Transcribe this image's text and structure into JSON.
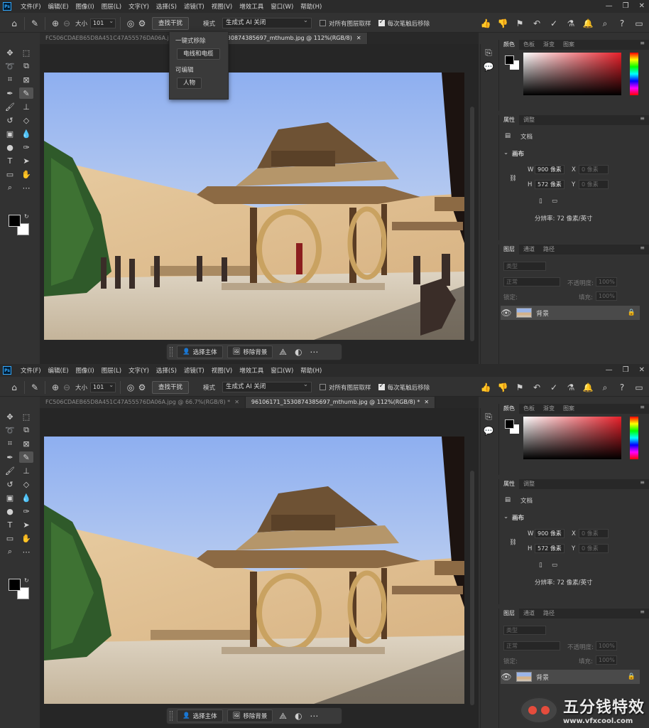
{
  "menu": [
    "文件(F)",
    "编辑(E)",
    "图像(I)",
    "图层(L)",
    "文字(Y)",
    "选择(S)",
    "滤镜(T)",
    "视图(V)",
    "增效工具",
    "窗口(W)",
    "帮助(H)"
  ],
  "options": {
    "size_label": "大小",
    "size_value": "101",
    "find_button": "查找干扰",
    "mode_label": "模式",
    "mode_value": "生成式 AI 关闭",
    "sample_all": "对所有图层取样",
    "remove_after": "每次笔触后移除"
  },
  "dropdown": {
    "heading1": "一键式移除",
    "item1": "电线和电缆",
    "heading2": "可编辑",
    "item2": "人物"
  },
  "tabs": {
    "top": [
      "FC506CDAEB65D8A451C47A55576DA06A.jpg",
      "96106171_1530874385697_mthumb.jpg @ 112%(RGB/8)"
    ],
    "bottom": [
      "FC506CDAEB65D8A451C47A55576DA06A.jpg @ 66.7%(RGB/8) *",
      "96106171_1530874385697_mthumb.jpg @ 112%(RGB/8) *"
    ]
  },
  "taskbar": {
    "select_subject": "选择主体",
    "remove_bg": "移除背景"
  },
  "color_panel": {
    "tabs": [
      "颜色",
      "色板",
      "渐变",
      "图案"
    ]
  },
  "properties": {
    "tabs": [
      "属性",
      "调整"
    ],
    "doc_label": "文档",
    "canvas_label": "画布",
    "w_label": "W",
    "w_value": "900 像素",
    "h_label": "H",
    "h_value": "572 像素",
    "x_label": "X",
    "x_placeholder": "0 像素",
    "y_label": "Y",
    "y_placeholder": "0 像素",
    "resolution": "分辨率: 72 像素/英寸"
  },
  "layers": {
    "tabs": [
      "图层",
      "通道",
      "路径"
    ],
    "kind_label": "类型",
    "blend_mode": "正常",
    "opacity_label": "不透明度:",
    "opacity_value": "100%",
    "lock_label": "锁定:",
    "fill_label": "填充:",
    "fill_value": "100%",
    "layer_name": "背景"
  },
  "watermark": {
    "cn": "五分钱特效",
    "url": "www.vfxcool.com"
  },
  "colors": {
    "accent": "#31a8ff",
    "panel": "#323232",
    "canvas_bg": "#262626"
  }
}
